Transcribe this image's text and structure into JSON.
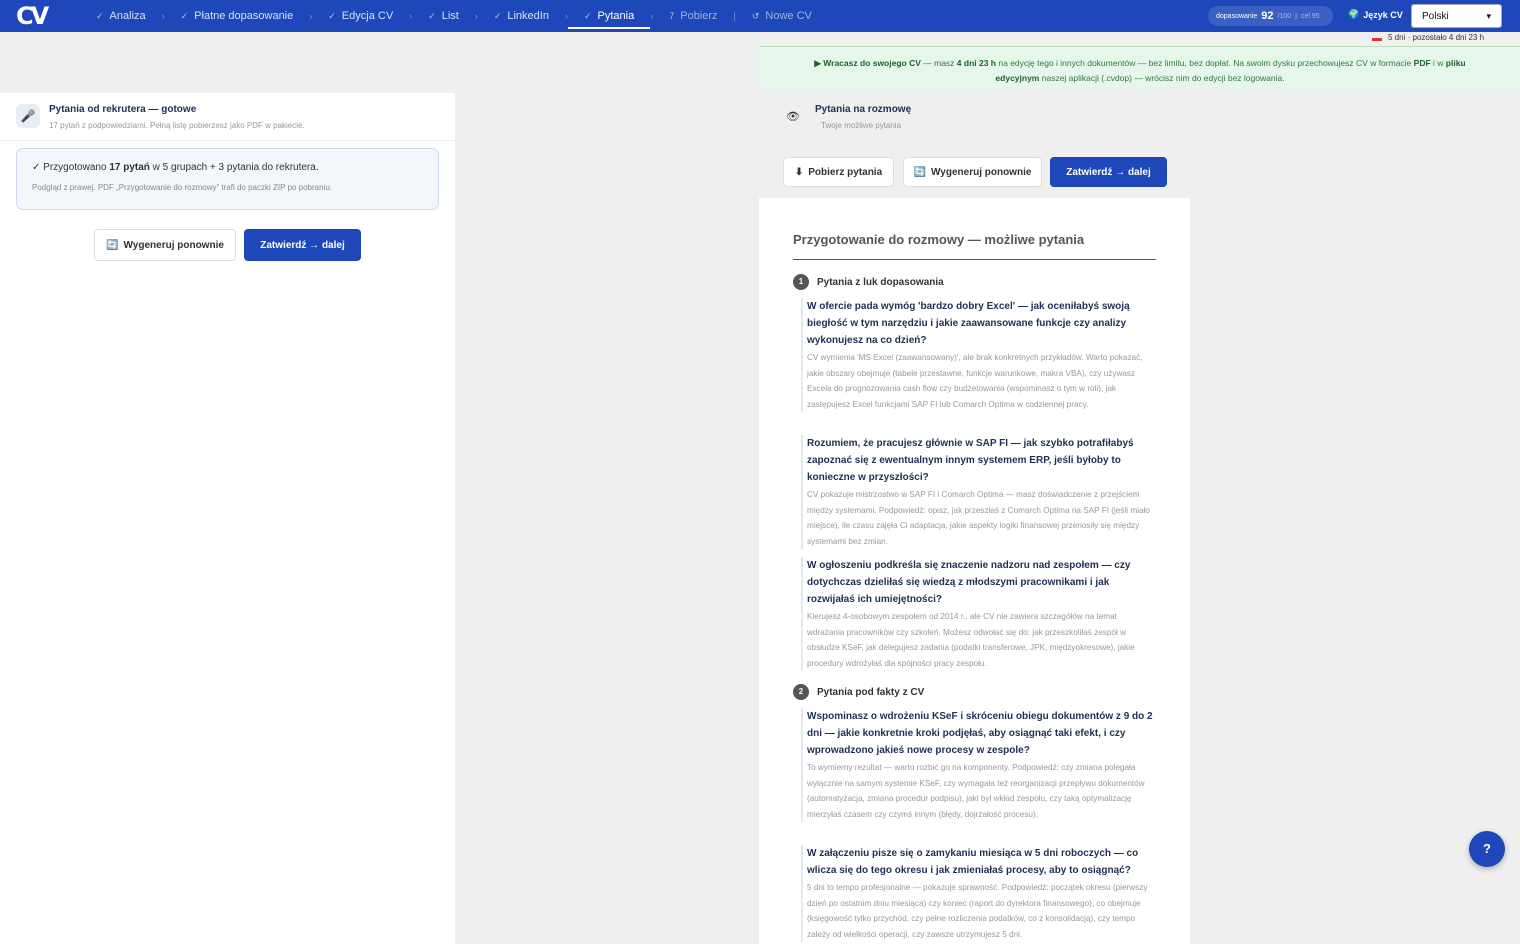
{
  "nav": {
    "logo": "CV",
    "steps": [
      {
        "label": "Analiza",
        "mark": "✓"
      },
      {
        "label": "Płatne dopasowanie",
        "mark": "✓"
      },
      {
        "label": "Edycja CV",
        "mark": "✓"
      },
      {
        "label": "List",
        "mark": "✓"
      },
      {
        "label": "LinkedIn",
        "mark": "✓"
      },
      {
        "label": "Pytania",
        "mark": "✓"
      },
      {
        "label": "Pobierz",
        "mark": "7"
      },
      {
        "label": "Nowe CV",
        "mark": "↺"
      }
    ],
    "fit_label": "dopasowanie",
    "fit_value": "92",
    "fit_max": "/100",
    "fit_target": "cel 95",
    "lang_label": "Język CV",
    "lang_selected": "Polski",
    "timer": "5 dni · pozostało 4 dni 23 h"
  },
  "banner": {
    "line1_a": "▶ Wracasz do swojego CV",
    "line1_b": " — masz ",
    "line1_c": "4 dni 23 h",
    "line1_d": " na edycję tego i innych dokumentów — bez limitu, bez dopłat. Na swoim dysku przechowujesz CV w formacie ",
    "line1_e": "PDF",
    "line1_f": " i w ",
    "line1_g": "pliku",
    "line2_a": "edycyjnym",
    "line2_b": " naszej aplikacji (.cvdop) — wrócisz nim do edycji bez logowania."
  },
  "left": {
    "title": "Pytania od rekrutera — gotowe",
    "subtitle": "17 pytań z podpowiedziami. Pełną listę pobierzesz jako PDF w pakiecie.",
    "info_a": "✓ Przygotowano ",
    "info_b": "17 pytań",
    "info_c": " w 5 grupach + 3 pytania do rekrutera.",
    "info2": "Podgląd z prawej. PDF „Przygotowanie do rozmowy” trafi do paczki ZIP po pobraniu.",
    "regen": "Wygeneruj ponownie",
    "confirm": "Zatwierdź → dalej"
  },
  "right": {
    "title": "Pytania na rozmowę",
    "subtitle": "Twoje możliwe pytania",
    "download": "Pobierz pytania",
    "regen": "Wygeneruj ponownie",
    "confirm": "Zatwierdź → dalej"
  },
  "doc": {
    "title": "Przygotowanie do rozmowy — możliwe pytania",
    "sections": [
      {
        "num": "1",
        "title": "Pytania z luk dopasowania"
      },
      {
        "num": "2",
        "title": "Pytania pod fakty z CV"
      }
    ],
    "questions": [
      {
        "q": "W ofercie pada wymóg 'bardzo dobry Excel' — jak oceniłabyś swoją biegłość w tym narzędziu i jakie zaawansowane funkcje czy analizy wykonujesz na co dzień?",
        "a": "CV wymienia 'MS Excel (zaawansowany)', ale brak konkretnych przykładów. Warto pokazać, jakie obszary obejmuje (tabele przestawne, funkcje warunkowe, makra VBA), czy używasz Excela do prognozowania cash flow czy budżetowania (wspominasz o tym w roli), jak zastępujesz Excel funkcjami SAP FI lub Comarch Optima w codziennej pracy."
      },
      {
        "q": "Rozumiem, że pracujesz głównie w SAP FI — jak szybko potrafiłabyś zapoznać się z ewentualnym innym systemem ERP, jeśli byłoby to konieczne w przyszłości?",
        "a": "CV pokazuje mistrzostwo w SAP FI i Comarch Optima — masz doświadczenie z przejściem między systemami. Podpowiedź: opisz, jak przeszłaś z Comarch Optima na SAP FI (jeśli miało miejsce), ile czasu zajęła Ci adaptacja, jakie aspekty logiki finansowej przenosiły się między systemami bez zmian."
      },
      {
        "q": "W ogłoszeniu podkreśla się znaczenie nadzoru nad zespołem — czy dotychczas dzieliłaś się wiedzą z młodszymi pracownikami i jak rozwijałaś ich umiejętności?",
        "a": "Kierujesz 4-osobowym zespołem od 2014 r., ale CV nie zawiera szczegółów na temat wdrażania pracowników czy szkoleń. Możesz odwołać się do: jak przeszkoliłaś zespół w obsłudze KSeF, jak delegujesz zadania (podatki transferowe, JPK, międzyokresowe), jakie procedury wdrożyłaś dla spójności pracy zespołu."
      },
      {
        "q": "Wspominasz o wdrożeniu KSeF i skróceniu obiegu dokumentów z 9 do 2 dni — jakie konkretnie kroki podjęłaś, aby osiągnąć taki efekt, i czy wprowadzono jakieś nowe procesy w zespole?",
        "a": "To wymierny rezultat — warto rozbić go na komponenty. Podpowiedź: czy zmiana polegała wyłącznie na samym systemie KSeF, czy wymagała też reorganizacji przepływu dokumentów (automatyzacja, zmiana procedur podpisu), jaki był wkład zespołu, czy taką optymalizację mierzyłaś czasem czy czymś innym (błędy, dojrzałość procesu)."
      },
      {
        "q": "W załączeniu pisze się o zamykaniu miesiąca w 5 dni roboczych — co wlicza się do tego okresu i jak zmieniałaś procesy, aby to osiągnąć?",
        "a": "5 dni to tempo profesjonalne — pokazuje sprawność. Podpowiedź: początek okresu (pierwszy dzień po ostatnim dniu miesiąca) czy koniec (raport do dyrektora finansowego), co obejmuje (księgowość tylko przychód, czy pełne rozliczenia podatków, co z konsolidacją), czy tempo zależy od wielkości operacji, czy zawsze utrzymujesz 5 dni."
      }
    ]
  },
  "help": "?"
}
